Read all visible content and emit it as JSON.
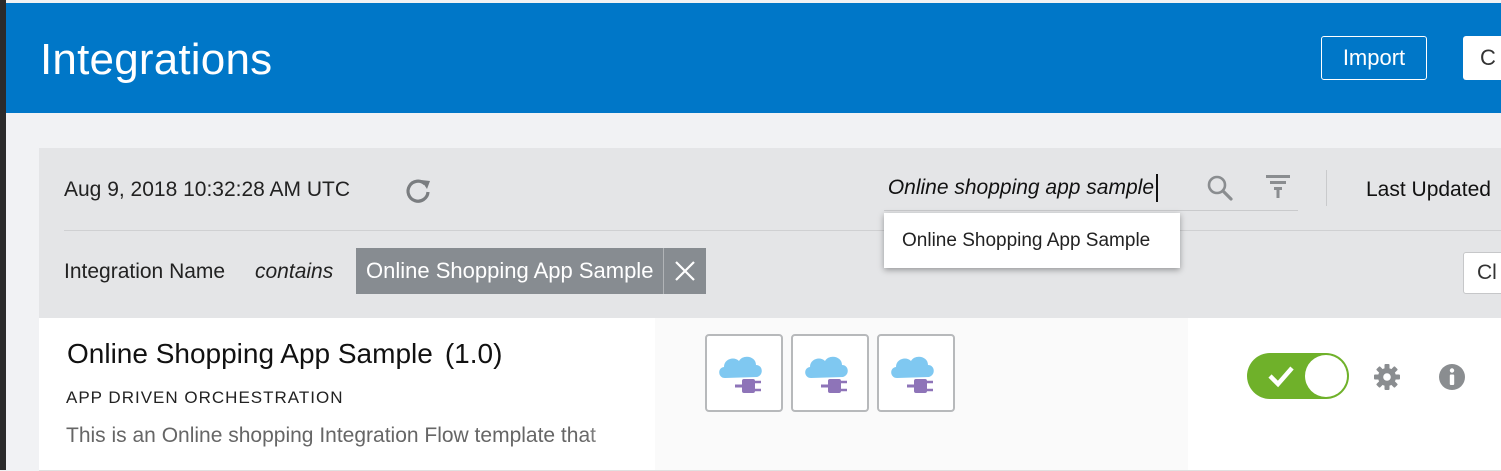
{
  "header": {
    "title": "Integrations",
    "import_label": "Import",
    "create_label_partial": "C"
  },
  "toolbar": {
    "timestamp": "Aug 9, 2018 10:32:28 AM UTC",
    "search_value": "Online shopping app sample",
    "sort_label": "Last Updated"
  },
  "filter": {
    "field": "Integration Name",
    "operator": "contains",
    "chip_value": "Online Shopping App Sample",
    "clear_label_partial": "Cl"
  },
  "suggestion": {
    "text": "Online Shopping App Sample"
  },
  "integration": {
    "name": "Online Shopping App Sample",
    "version": "(1.0)",
    "type": "APP DRIVEN ORCHESTRATION",
    "description": "This is an Online shopping Integration Flow template that",
    "connections": [
      "cloud-adapter-icon",
      "cloud-adapter-icon",
      "cloud-adapter-icon"
    ],
    "active": true
  },
  "colors": {
    "header_bg": "#0077c8",
    "toggle_on": "#6fb12a",
    "chip_bg": "#878c91"
  }
}
